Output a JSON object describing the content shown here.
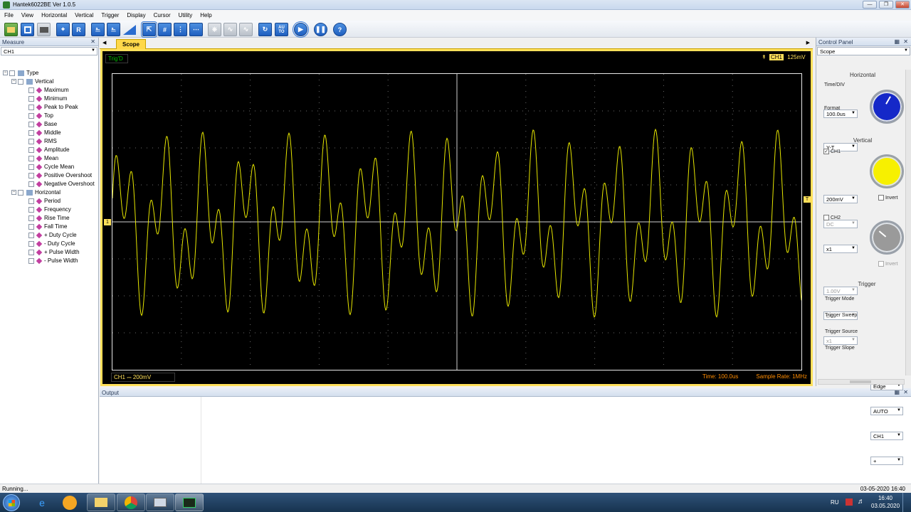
{
  "window": {
    "title": "Hantek6022BE Ver 1.0.5"
  },
  "menu": [
    "File",
    "View",
    "Horizontal",
    "Vertical",
    "Trigger",
    "Display",
    "Cursor",
    "Utility",
    "Help"
  ],
  "toolbar": {
    "buttons": [
      {
        "name": "open-button",
        "icon": "open-folder-icon"
      },
      {
        "name": "save-button",
        "icon": "save-icon"
      },
      {
        "name": "print-button",
        "icon": "print-icon"
      },
      {
        "name": "auto-scale-button",
        "icon": "auto-scale-icon"
      },
      {
        "name": "reset-button",
        "icon": "r-icon",
        "glyph": "R"
      },
      {
        "name": "ch1-waveform-button",
        "icon": "square-wave-icon"
      },
      {
        "name": "ch2-waveform-button",
        "icon": "square-wave-2-icon"
      },
      {
        "name": "ramp-button",
        "icon": "ramp-icon"
      },
      {
        "name": "select-cursor-button",
        "icon": "select-icon"
      },
      {
        "name": "grid-button",
        "icon": "grid-icon"
      },
      {
        "name": "cursor-v-button",
        "icon": "vertical-cursor-icon"
      },
      {
        "name": "cursor-h-button",
        "icon": "horizontal-cursor-icon"
      },
      {
        "name": "step-wave-button",
        "icon": "step-wave-icon"
      },
      {
        "name": "sine-wave-button",
        "icon": "sine-wave-icon"
      },
      {
        "name": "sine-wave-2-button",
        "icon": "sine-wave-2-icon"
      },
      {
        "name": "refresh-button",
        "icon": "refresh-icon"
      },
      {
        "name": "auto-button",
        "icon": "auto-icon",
        "glyph": "AU TO"
      },
      {
        "name": "run-button",
        "icon": "play-icon"
      },
      {
        "name": "pause-button",
        "icon": "pause-icon"
      },
      {
        "name": "help-button",
        "icon": "help-icon",
        "glyph": "?"
      }
    ]
  },
  "measure": {
    "header": "Measure",
    "channel": "CH1",
    "tree": {
      "root": "Type",
      "vertical_label": "Vertical",
      "vertical": [
        "Maximum",
        "Minimum",
        "Peak to Peak",
        "Top",
        "Base",
        "Middle",
        "RMS",
        "Amplitude",
        "Mean",
        "Cycle Mean",
        "Positive Overshoot",
        "Negative Overshoot"
      ],
      "horizontal_label": "Horizontal",
      "horizontal": [
        "Period",
        "Frequency",
        "Rise Time",
        "Fall Time",
        "+ Duty Cycle",
        "- Duty Cycle",
        "+ Pulse Width",
        "- Pulse Width"
      ]
    }
  },
  "scope": {
    "tab": "Scope",
    "trig_status": "Trig'D",
    "trig_channel": "CH1",
    "trig_level": "125mV",
    "ch1_marker": "1",
    "trig_marker": "T",
    "ch1_label": "CH1 ⎓ 200mV",
    "time_label": "Time: 100.0us",
    "sample_rate": "Sample Rate: 1MHz",
    "colors": {
      "trace": "#e6e600",
      "grid": "#6a6a6a",
      "frame": "#ffe05a",
      "text": "#ff8c00",
      "trig": "#00c000"
    }
  },
  "output": {
    "header": "Output"
  },
  "control": {
    "header": "Control Panel",
    "mode": "Scope",
    "horizontal": {
      "title": "Horizontal",
      "time_div_label": "Time/DIV",
      "time_div": "100.0us",
      "format_label": "Format",
      "format": "Y-T",
      "knob_color": "#1528c8"
    },
    "vertical": {
      "title": "Vertical",
      "ch1": {
        "label": "CH1",
        "checked": true,
        "volt": "200mV",
        "coupling": "DC",
        "probe": "x1",
        "invert": "Invert",
        "knob_color": "#f7f000"
      },
      "ch2": {
        "label": "CH2",
        "checked": false,
        "volt": "1.00V",
        "coupling": "DC",
        "probe": "x1",
        "invert": "Invert",
        "knob_color": "#9a9a9a"
      }
    },
    "trigger": {
      "title": "Trigger",
      "mode_label": "Trigger Mode",
      "mode": "Edge",
      "sweep_label": "Trigger Sweep",
      "sweep": "AUTO",
      "source_label": "Trigger Source",
      "source": "CH1",
      "slope_label": "Trigger Slope",
      "slope": "+"
    }
  },
  "status": {
    "left": "Running...",
    "right": "03-05-2020  16:40"
  },
  "taskbar": {
    "lang": "RU",
    "time": "16:40",
    "date": "03.05.2020"
  }
}
